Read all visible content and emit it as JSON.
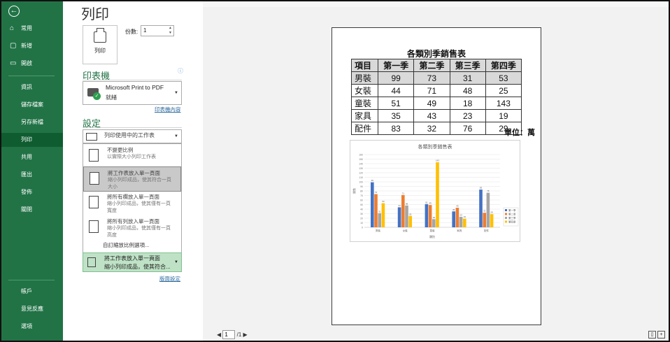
{
  "nav": {
    "back_icon": "back-arrow-icon",
    "items": [
      {
        "label": "常用",
        "icon": "home-icon"
      },
      {
        "label": "新增",
        "icon": "new-document-icon"
      },
      {
        "label": "開啟",
        "icon": "folder-open-icon"
      }
    ],
    "items2": [
      {
        "label": "資訊"
      },
      {
        "label": "儲存檔案"
      },
      {
        "label": "另存新檔"
      },
      {
        "label": "列印",
        "active": true
      },
      {
        "label": "共用"
      },
      {
        "label": "匯出"
      },
      {
        "label": "發佈"
      },
      {
        "label": "關閉"
      }
    ],
    "bottom": [
      {
        "label": "帳戶"
      },
      {
        "label": "意見反應"
      },
      {
        "label": "選項"
      }
    ]
  },
  "page_title": "列印",
  "print_button_label": "列印",
  "copies": {
    "label": "份數:",
    "value": "1"
  },
  "printer": {
    "section": "印表機",
    "name": "Microsoft Print to PDF",
    "status": "就緒",
    "properties_link": "印表機內容"
  },
  "settings": {
    "section": "設定",
    "what_to_print": "列印使用中的工作表",
    "scaling_options": [
      {
        "title": "不變更比例",
        "desc1": "以實際大小列印工作表",
        "desc2": ""
      },
      {
        "title": "將工作表放入單一頁面",
        "desc1": "縮小列印成品，使其符合一頁",
        "desc2": "大小",
        "selected": true
      },
      {
        "title": "將所有欄放入單一頁面",
        "desc1": "縮小列印成品，使其僅有一頁",
        "desc2": "寬度"
      },
      {
        "title": "將所有列放入單一頁面",
        "desc1": "縮小列印成品，使其僅有一頁",
        "desc2": "高度"
      }
    ],
    "custom_scaling": "自訂縮放比例選項...",
    "current_scaling_title": "將工作表放入單一頁面",
    "current_scaling_desc": "縮小列印成品，使其符合...",
    "page_setup_link": "版面設定"
  },
  "preview": {
    "table_title": "各類別季銷售表",
    "headers": [
      "項目",
      "第一季",
      "第二季",
      "第三季",
      "第四季"
    ],
    "rows": [
      [
        "男裝",
        "99",
        "73",
        "31",
        "53"
      ],
      [
        "女裝",
        "44",
        "71",
        "48",
        "25"
      ],
      [
        "童裝",
        "51",
        "49",
        "18",
        "143"
      ],
      [
        "家具",
        "35",
        "43",
        "23",
        "19"
      ],
      [
        "配件",
        "83",
        "32",
        "76",
        "29"
      ]
    ],
    "unit": "單位：萬",
    "page_current": "1",
    "page_total": "/1"
  },
  "chart_data": {
    "type": "bar",
    "title": "各類別季銷售表",
    "xlabel": "類別",
    "ylabel": "銷售",
    "categories": [
      "男裝",
      "女裝",
      "童裝",
      "家具",
      "配件"
    ],
    "series": [
      {
        "name": "第一季",
        "values": [
          99,
          44,
          51,
          35,
          83
        ],
        "color": "#4472c4"
      },
      {
        "name": "第二季",
        "values": [
          73,
          71,
          49,
          43,
          32
        ],
        "color": "#ed7d31"
      },
      {
        "name": "第三季",
        "values": [
          31,
          48,
          18,
          23,
          76
        ],
        "color": "#a5a5a5"
      },
      {
        "name": "第四季",
        "values": [
          53,
          25,
          143,
          19,
          29
        ],
        "color": "#ffc000"
      }
    ],
    "ylim": [
      0,
      160
    ],
    "yticks": [
      "0",
      "10",
      "20",
      "30",
      "40",
      "50",
      "60",
      "70",
      "80",
      "90",
      "100",
      "110",
      "120",
      "130",
      "140",
      "150",
      "160"
    ],
    "grid": true,
    "legend": "right"
  }
}
